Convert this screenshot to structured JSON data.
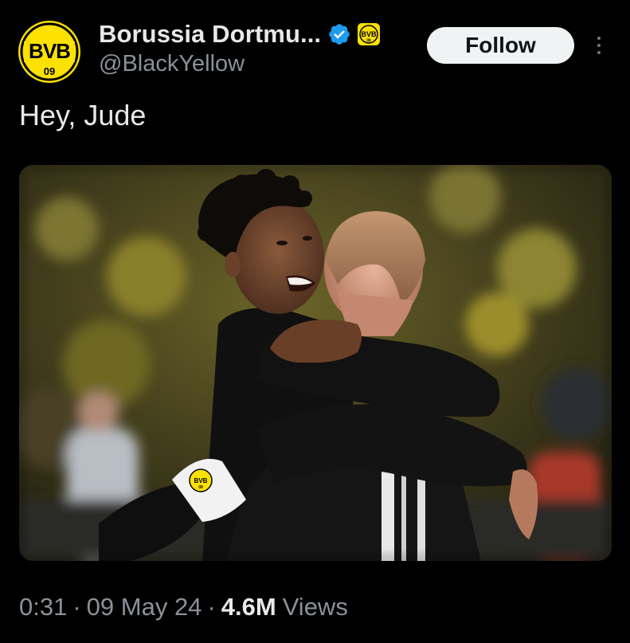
{
  "author": {
    "display_name": "Borussia Dortmu...",
    "handle": "@BlackYellow",
    "avatar_text": "BVB 09",
    "verified_icon": "verified-badge-icon",
    "affiliate_badge_text": "BVB 09"
  },
  "actions": {
    "follow_label": "Follow",
    "more_icon": "more-options-icon"
  },
  "tweet": {
    "text": "Hey, Jude",
    "media_alt": "Two players in black kits embracing at a stadium",
    "armband_text": "BVB 09"
  },
  "meta": {
    "time": "0:31",
    "sep1": "·",
    "date": "09 May 24",
    "sep2": "·",
    "views_count": "4.6M",
    "views_label": "Views"
  },
  "colors": {
    "background": "#000000",
    "text_primary": "#e7e9ea",
    "text_secondary": "#8b9197",
    "bvb_yellow": "#fde100",
    "verified_blue": "#1d9bf0",
    "follow_bg": "#eff3f4"
  }
}
